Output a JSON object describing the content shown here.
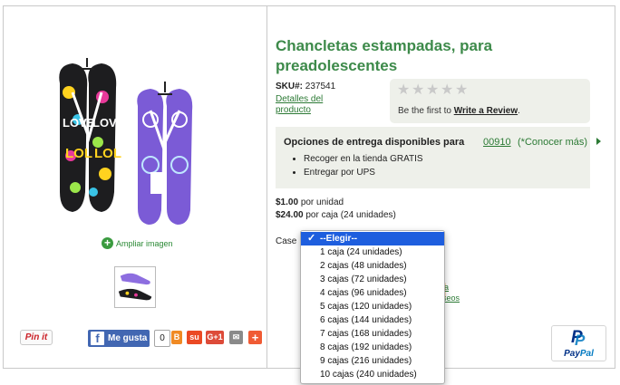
{
  "product": {
    "title": "Chancletas estampadas, para preadolescentes",
    "sku_label": "SKU#:",
    "sku_value": "237541",
    "details_link": "Detalles del producto",
    "zoom_link": "Ampliar imagen"
  },
  "review": {
    "stars_filled": 0,
    "stars_total": 5,
    "prompt": "Be the first to",
    "link": "Write a Review",
    "suffix": "."
  },
  "delivery": {
    "heading": "Opciones de entrega disponibles para",
    "zip": "00910",
    "learn_more": "(*Conocer más)",
    "options": [
      "Recoger en la tienda GRATIS",
      "Entregar por UPS"
    ]
  },
  "pricing": {
    "unit_price": "$1.00",
    "unit_label": "por unidad",
    "case_price": "$24.00",
    "case_label": "por caja (24 unidades)"
  },
  "case_select": {
    "label": "Case",
    "selected": "--Elegir--",
    "options": [
      "--Elegir--",
      "1 caja (24 unidades)",
      "2 cajas (48 unidades)",
      "3 cajas (72 unidades)",
      "4 cajas (96 unidades)",
      "5 cajas (120 unidades)",
      "6 cajas (144 unidades)",
      "7 cajas (168 unidades)",
      "8 cajas (192 unidades)",
      "9 cajas (216 unidades)",
      "10 cajas (240 unidades)"
    ],
    "partial_link": "la\nseos"
  },
  "social": {
    "pinit": "Pin it",
    "fb_like": "Me gusta",
    "fb_count": "0",
    "gplus": "G+1"
  },
  "paypal": {
    "pay": "Pay",
    "pal": "Pal"
  },
  "colors": {
    "brand_green": "#3d8a4a",
    "link_green": "#2c7a35",
    "panel_bg": "#eef0ea",
    "select_highlight": "#1e5ede"
  }
}
